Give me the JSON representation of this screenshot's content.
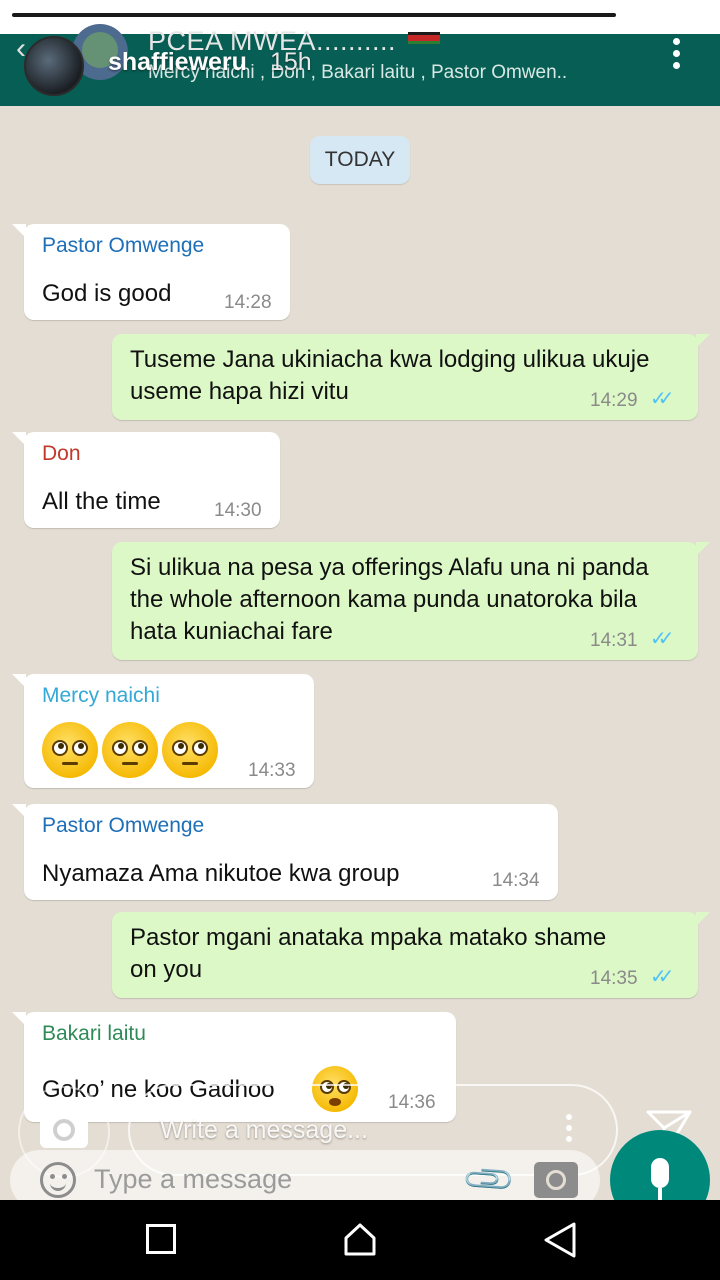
{
  "group": {
    "name": "PCEA MWEA..........",
    "members": "Mercy naichi , Don , Bakari laitu , Pastor Omwen.."
  },
  "story": {
    "username": "shaffieweru",
    "time": "15h",
    "reply_placeholder": "Write a message..."
  },
  "chat": {
    "date": "TODAY",
    "messages": [
      {
        "direction": "in",
        "sender": "Pastor Omwenge",
        "sender_color": "#1e6fb8",
        "text": "God is good",
        "time": "14:28"
      },
      {
        "direction": "out",
        "text": "Tuseme Jana ukiniacha kwa lodging ulikua ukuje useme hapa hizi vitu",
        "time": "14:29"
      },
      {
        "direction": "in",
        "sender": "Don",
        "sender_color": "#c0392b",
        "text": "All the time",
        "time": "14:30"
      },
      {
        "direction": "out",
        "text": "Si ulikua na pesa ya offerings Alafu una ni panda the whole afternoon kama punda unatoroka bila hata kuniachai fare",
        "time": "14:31"
      },
      {
        "direction": "in",
        "sender": "Mercy naichi",
        "sender_color": "#35a8d6",
        "emoji": "face-with-rolling-eyes-x3",
        "time": "14:33"
      },
      {
        "direction": "in",
        "sender": "Pastor Omwenge",
        "sender_color": "#1e6fb8",
        "text": "Nyamaza Ama nikutoe kwa group",
        "time": "14:34"
      },
      {
        "direction": "out",
        "text": "Pastor mgani anataka mpaka matako shame on you",
        "time": "14:35"
      },
      {
        "direction": "in",
        "sender": "Bakari laitu",
        "sender_color": "#2e8b57",
        "text": "Goko’ ne koo Gadhoo",
        "emoji": "flushed-face",
        "time": "14:36"
      }
    ]
  },
  "composer": {
    "placeholder": "Type a message"
  },
  "icons": {
    "header_menu": "more-vert-icon",
    "status": "double-check-icon",
    "send": "send-icon",
    "mic": "mic-icon",
    "attach": "paperclip-icon",
    "camera": "camera-icon",
    "emoji": "smile-icon"
  },
  "colors": {
    "header": "#075e54",
    "outgoing_bubble": "#dcf8c6",
    "incoming_bubble": "#ffffff",
    "chat_background": "#e4ddd3",
    "read_ticks": "#4fc3f7",
    "mic_button": "#00897b"
  }
}
